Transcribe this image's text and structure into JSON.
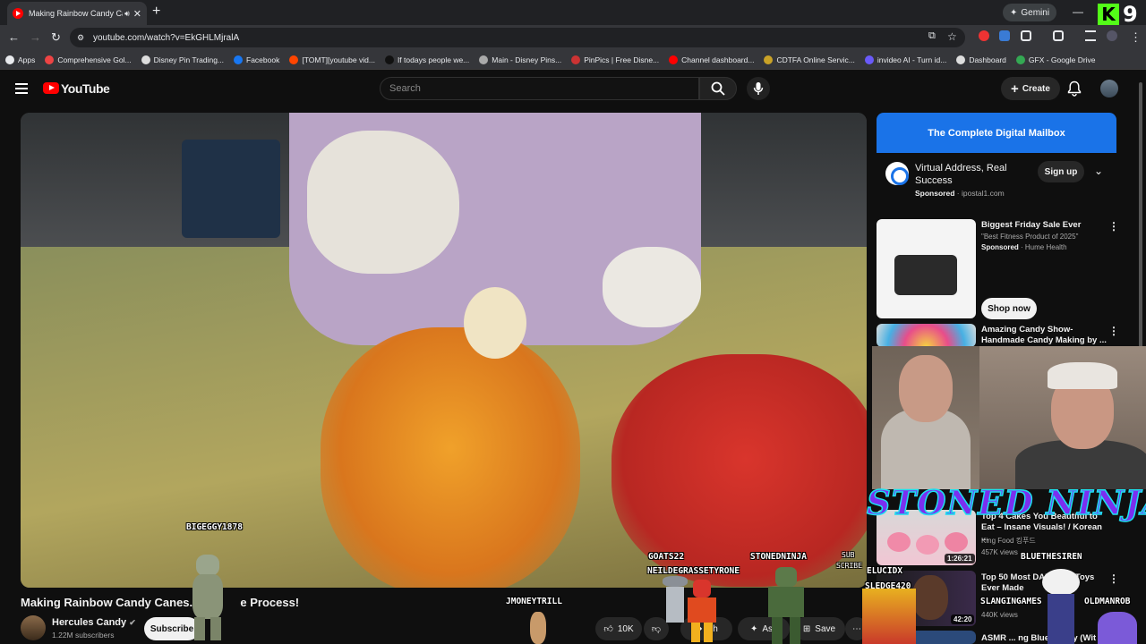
{
  "browser": {
    "tab_title": "Making Rainbow Candy Canes",
    "gemini_label": "Gemini",
    "url": "youtube.com/watch?v=EkGHLMjralA",
    "kick_letter": "K",
    "kick_number": "9",
    "bookmarks": [
      {
        "label": "Apps",
        "color": "#e8eaed"
      },
      {
        "label": "Comprehensive Gol...",
        "color": "#e44"
      },
      {
        "label": "Disney Pin Trading...",
        "color": "#ddd"
      },
      {
        "label": "Facebook",
        "color": "#1877f2"
      },
      {
        "label": "[TOMT][youtube vid...",
        "color": "#ff4500"
      },
      {
        "label": "If todays people we...",
        "color": "#111"
      },
      {
        "label": "Main - Disney Pins...",
        "color": "#aaa"
      },
      {
        "label": "PinPics | Free Disne...",
        "color": "#c33"
      },
      {
        "label": "Channel dashboard...",
        "color": "#f00"
      },
      {
        "label": "CDTFA Online Servic...",
        "color": "#c9a227"
      },
      {
        "label": "invideo AI - Turn id...",
        "color": "#6a5af9"
      },
      {
        "label": "Dashboard",
        "color": "#ddd"
      },
      {
        "label": "GFX - Google Drive",
        "color": "#34a853"
      }
    ]
  },
  "youtube": {
    "logo_text": "YouTube",
    "search_placeholder": "Search",
    "create_label": "Create"
  },
  "video": {
    "title_left": "Making Rainbow Candy Canes...",
    "title_right": "e Process!",
    "channel_name": "Hercules Candy",
    "subscribers": "1.22M subscribers",
    "subscribe_label": "Subscribe",
    "likes": "10K",
    "share_label": "Sh",
    "ask_label": "Ask",
    "save_label": "Save"
  },
  "ad": {
    "banner": "The Complete Digital Mailbox",
    "title": "Virtual Address, Real Success",
    "sponsored": "Sponsored",
    "domain": "· ipostal1.com",
    "signup_label": "Sign up"
  },
  "recommendations": [
    {
      "title": "Biggest Friday Sale Ever",
      "sub1": "\"Best Fitness Product of 2025\"",
      "sponsored": "Sponsored",
      "sub2": "· Hume Health",
      "cta": "Shop now"
    },
    {
      "title": "Amazing Candy Show-Handmade Candy Making by ..."
    },
    {
      "title": "Top 4 Cakes You Beautiful to Eat – Insane Visuals! / Korean ...",
      "channel": "King Food 킹푸드",
      "views": "457K views",
      "duration": "1:26:21"
    },
    {
      "title": "Top 50 Most DANG... S Toys Ever Made",
      "views": "440K views",
      "duration": "42:20"
    },
    {
      "title": "ASMR ... ng Blue Candy (Wit"
    }
  ],
  "stream_overlay": {
    "banner_text": "STONED NINJA",
    "names": [
      "BIGEGGY1878",
      "GOATS22",
      "STONEDNINJA",
      "NEILDEGRASSETYRONE",
      "JMONEYTRILL",
      "ELUCIDX",
      "SLEDGE420",
      "SLANGINGAMES",
      "OLDMANROB",
      "BLUETHESIREN"
    ],
    "sub_label_1": "SUB",
    "sub_label_2": "SCRIBE"
  },
  "colors": {
    "accent_blue": "#1a73e8",
    "youtube_red": "#ff0000",
    "kick_green": "#53fc18",
    "ninja_purple": "#7b2ff0",
    "ninja_outline": "#1de0f0"
  }
}
